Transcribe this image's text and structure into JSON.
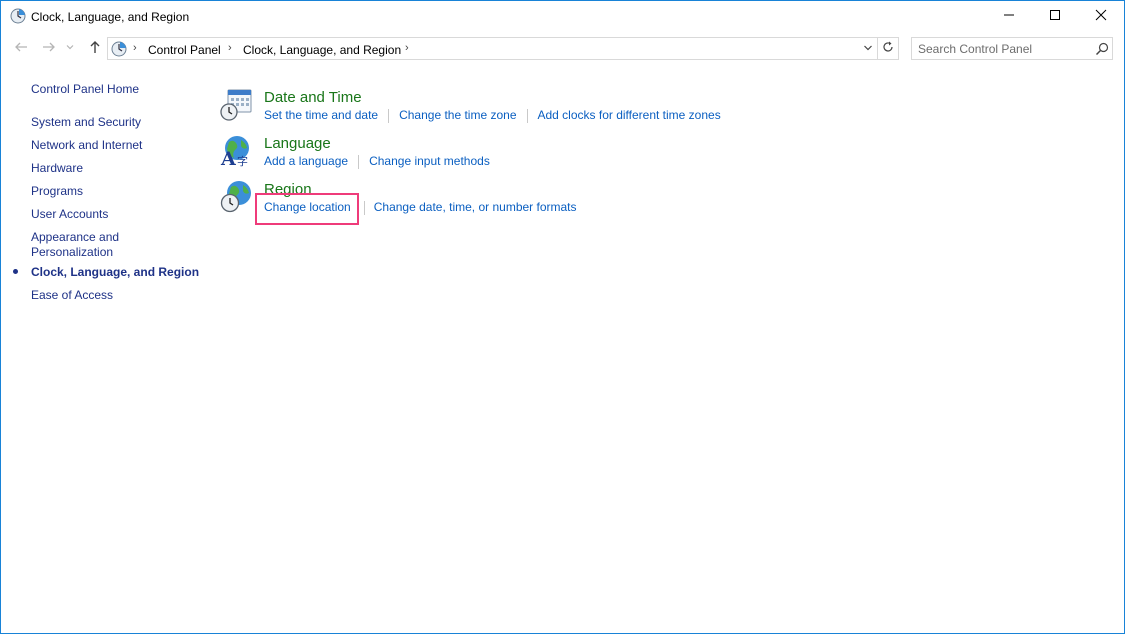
{
  "window": {
    "title": "Clock, Language, and Region",
    "border_color": "#1883d7"
  },
  "controls": {
    "minimize_icon": "minimize-icon",
    "maximize_icon": "maximize-icon",
    "close_icon": "close-icon"
  },
  "address": {
    "crumbs": [
      "Control Panel",
      "Clock, Language, and Region"
    ],
    "separator": "›"
  },
  "search": {
    "placeholder": "Search Control Panel"
  },
  "sidebar": {
    "items": [
      {
        "label": "Control Panel Home",
        "active": false
      },
      {
        "label": "System and Security",
        "active": false
      },
      {
        "label": "Network and Internet",
        "active": false
      },
      {
        "label": "Hardware",
        "active": false
      },
      {
        "label": "Programs",
        "active": false
      },
      {
        "label": "User Accounts",
        "active": false
      },
      {
        "label": "Appearance and Personalization",
        "active": false
      },
      {
        "label": "Clock, Language, and Region",
        "active": true
      },
      {
        "label": "Ease of Access",
        "active": false
      }
    ],
    "link_color": "#1e3287"
  },
  "categories": [
    {
      "title": "Date and Time",
      "icon": "calendar-clock-icon",
      "links": [
        "Set the time and date",
        "Change the time zone",
        "Add clocks for different time zones"
      ]
    },
    {
      "title": "Language",
      "icon": "language-globe-icon",
      "links": [
        "Add a language",
        "Change input methods"
      ]
    },
    {
      "title": "Region",
      "icon": "region-globe-clock-icon",
      "links": [
        "Change location",
        "Change date, time, or number formats"
      ],
      "highlighted_link": "Change location"
    }
  ],
  "colors": {
    "category_title": "#197619",
    "task_link": "#0b5fc1",
    "highlight": "#ef3b7a"
  }
}
